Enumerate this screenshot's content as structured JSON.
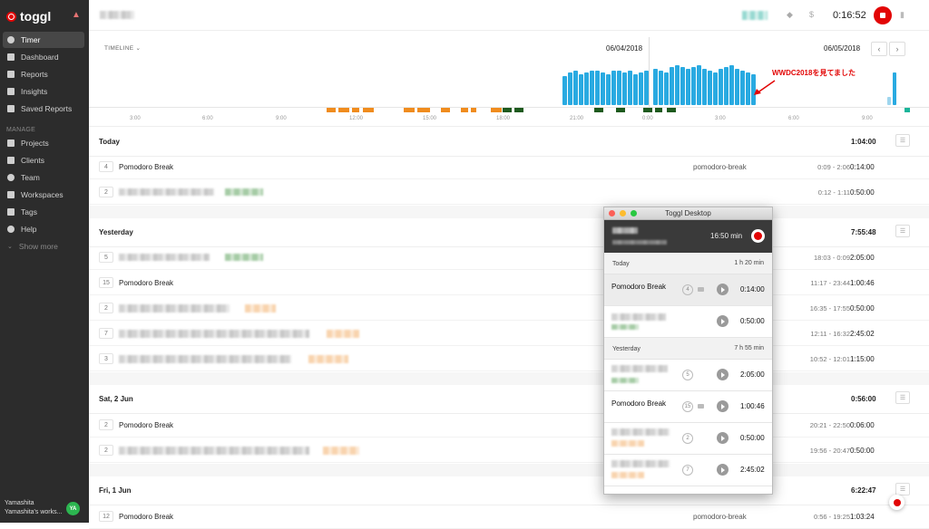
{
  "sidebar": {
    "brand": "toggl",
    "nav": [
      {
        "label": "Timer",
        "icon": "clock-icon",
        "active": true
      },
      {
        "label": "Dashboard",
        "icon": "bar-chart-icon"
      },
      {
        "label": "Reports",
        "icon": "report-icon"
      },
      {
        "label": "Insights",
        "icon": "insights-icon"
      },
      {
        "label": "Saved Reports",
        "icon": "star-icon"
      }
    ],
    "manage_label": "MANAGE",
    "manage": [
      {
        "label": "Projects",
        "icon": "folder-icon"
      },
      {
        "label": "Clients",
        "icon": "client-icon"
      },
      {
        "label": "Team",
        "icon": "team-icon"
      },
      {
        "label": "Workspaces",
        "icon": "briefcase-icon"
      },
      {
        "label": "Tags",
        "icon": "tag-icon"
      },
      {
        "label": "Help",
        "icon": "help-icon"
      },
      {
        "label": "Show more",
        "icon": "chevron-down-icon"
      }
    ],
    "user_name": "Yamashita",
    "workspace": "Yamashita's works...",
    "avatar_initials": "YA"
  },
  "topbar": {
    "timer": "0:16:52",
    "dollar": "$"
  },
  "timeline": {
    "label": "TIMELINE",
    "date_left": "06/04/2018",
    "date_right": "06/05/2018",
    "ticks": [
      "3:00",
      "6:00",
      "9:00",
      "12:00",
      "15:00",
      "18:00",
      "21:00",
      "0:00",
      "3:00",
      "6:00",
      "9:00"
    ],
    "annotation": "WWDC2018を見てました"
  },
  "days": [
    {
      "name": "Today",
      "total": "1:04:00",
      "rows": [
        {
          "count": "4",
          "desc": "Pomodoro Break",
          "project": "pomodoro-break",
          "range": "0:09 - 2:06",
          "dur": "0:14:00"
        },
        {
          "count": "2",
          "desc": "",
          "project": "",
          "range": "0:12 - 1:11",
          "dur": "0:50:00"
        }
      ]
    },
    {
      "name": "Yesterday",
      "total": "7:55:48",
      "rows": [
        {
          "count": "5",
          "desc": "",
          "project": "",
          "range": "18:03 - 0:09",
          "dur": "2:05:00"
        },
        {
          "count": "15",
          "desc": "Pomodoro Break",
          "project": "",
          "range": "11:17 - 23:44",
          "dur": "1:00:46"
        },
        {
          "count": "2",
          "desc": "",
          "project": "",
          "range": "16:35 - 17:55",
          "dur": "0:50:00"
        },
        {
          "count": "7",
          "desc": "",
          "project": "",
          "range": "12:11 - 16:32",
          "dur": "2:45:02"
        },
        {
          "count": "3",
          "desc": "",
          "project": "",
          "range": "10:52 - 12:01",
          "dur": "1:15:00"
        }
      ]
    },
    {
      "name": "Sat, 2 Jun",
      "total": "0:56:00",
      "rows": [
        {
          "count": "2",
          "desc": "Pomodoro Break",
          "project": "",
          "range": "20:21 - 22:50",
          "dur": "0:06:00"
        },
        {
          "count": "2",
          "desc": "",
          "project": "",
          "range": "19:56 - 20:47",
          "dur": "0:50:00"
        }
      ]
    },
    {
      "name": "Fri, 1 Jun",
      "total": "6:22:47",
      "rows": [
        {
          "count": "12",
          "desc": "Pomodoro Break",
          "project": "pomodoro-break",
          "range": "0:56 - 19:25",
          "dur": "1:03:24"
        }
      ]
    }
  ],
  "desktop": {
    "title": "Toggl Desktop",
    "running": "16:50 min",
    "today_label": "Today",
    "today_total": "1 h 20 min",
    "yesterday_label": "Yesterday",
    "yesterday_total": "7 h 55 min",
    "today_rows": [
      {
        "desc": "Pomodoro Break",
        "count": "4",
        "dur": "0:14:00"
      },
      {
        "desc": "",
        "count": "",
        "dur": "0:50:00"
      }
    ],
    "yesterday_rows": [
      {
        "desc": "",
        "count": "5",
        "dur": "2:05:00"
      },
      {
        "desc": "Pomodoro Break",
        "count": "15",
        "dur": "1:00:46"
      },
      {
        "desc": "",
        "count": "2",
        "dur": "0:50:00"
      },
      {
        "desc": "",
        "count": "7",
        "dur": "2:45:02"
      }
    ]
  },
  "colors": {
    "accent": "#e20505",
    "timeline_bar": "#29aae1",
    "orange": "#f08c1e",
    "dark_green": "#1e5a1e"
  }
}
